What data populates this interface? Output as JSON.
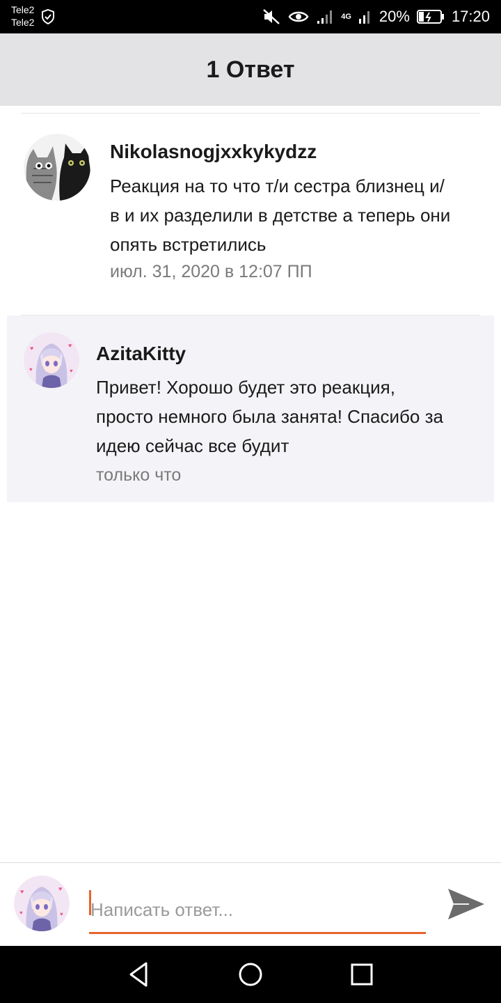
{
  "status_bar": {
    "carrier_1": "Tele2",
    "carrier_2": "Tele2",
    "network": "4G",
    "battery": "20%",
    "time": "17:20"
  },
  "header": {
    "title": "1 Ответ"
  },
  "comments": [
    {
      "author": "Nikolasnogjxxkykydzz",
      "body_lines": [
        "Реакция на то что т/и сестра близнец и/",
        "в и их разделили в детстве а теперь они",
        "опять встретились"
      ],
      "time": "июл. 31, 2020 в 12:07 ПП",
      "avatar": "cats-avatar"
    },
    {
      "author": "AzitaKitty",
      "body_lines": [
        "Привет! Хорошо будет это реакция,",
        "просто немного была занята! Спасибо за",
        "идею сейчас все будит"
      ],
      "time": "только что",
      "avatar": "anime-girl-avatar"
    }
  ],
  "reply": {
    "placeholder": "Написать ответ...",
    "value": ""
  },
  "colors": {
    "accent": "#e8632c",
    "header_bg": "#e3e2e5",
    "reply_bg": "#f4f3f7"
  }
}
